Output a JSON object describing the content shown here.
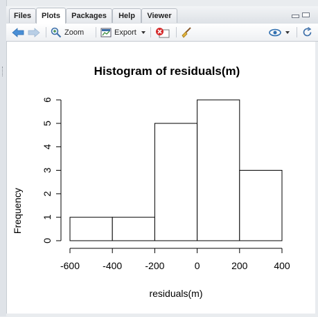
{
  "tabs": [
    {
      "label": "Files",
      "active": false
    },
    {
      "label": "Plots",
      "active": true
    },
    {
      "label": "Packages",
      "active": false
    },
    {
      "label": "Help",
      "active": false
    },
    {
      "label": "Viewer",
      "active": false
    }
  ],
  "toolbar": {
    "zoom_label": "Zoom",
    "export_label": "Export",
    "export_dropdown_icon": "chevron-down-icon",
    "icons": [
      "back-arrow-icon",
      "forward-arrow-icon",
      "zoom-icon",
      "export-icon",
      "remove-plot-icon",
      "broom-icon",
      "publish-icon",
      "refresh-icon"
    ]
  },
  "colors": {
    "back_arrow": "#4a8fd6",
    "forward_arrow": "#b9cfe6",
    "bars_fill": "#ffffff",
    "bars_stroke": "#000000"
  },
  "chart_data": {
    "type": "bar",
    "title": "Histogram of residuals(m)",
    "xlabel": "residuals(m)",
    "ylabel": "Frequency",
    "bins": [
      {
        "from": -600,
        "to": -400,
        "count": 1
      },
      {
        "from": -400,
        "to": -200,
        "count": 1
      },
      {
        "from": -200,
        "to": 0,
        "count": 5
      },
      {
        "from": 0,
        "to": 200,
        "count": 6
      },
      {
        "from": 200,
        "to": 400,
        "count": 3
      }
    ],
    "xticks": [
      -600,
      -400,
      -200,
      0,
      200,
      400
    ],
    "yticks": [
      0,
      1,
      2,
      3,
      4,
      5,
      6
    ],
    "xlim": [
      -600,
      400
    ],
    "ylim": [
      0,
      6
    ],
    "grid": false
  }
}
